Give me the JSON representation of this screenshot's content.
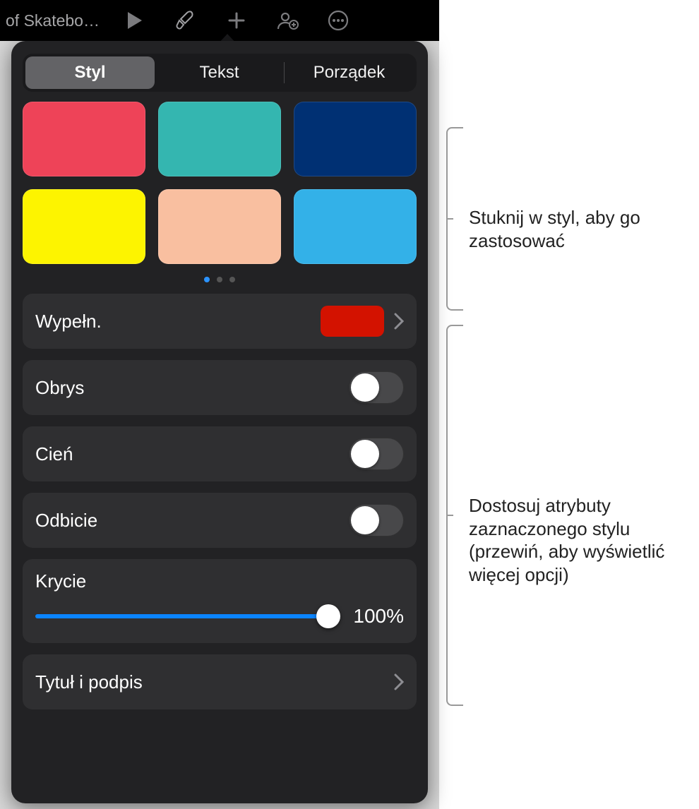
{
  "toolbar": {
    "title": "of Skatebo…"
  },
  "tabs": {
    "style": "Styl",
    "text": "Tekst",
    "arrange": "Porządek"
  },
  "swatches": [
    "#ee4358",
    "#34b6b0",
    "#003073",
    "#fdf400",
    "#f9bfa0",
    "#33b1e8"
  ],
  "active_dot": 0,
  "rows": {
    "fill_label": "Wypełn.",
    "fill_color": "#d31200",
    "stroke_label": "Obrys",
    "shadow_label": "Cień",
    "reflection_label": "Odbicie",
    "opacity_label": "Krycie",
    "opacity_value": "100%",
    "title_caption_label": "Tytuł i podpis"
  },
  "callouts": {
    "top": "Stuknij w styl, aby go zastosować",
    "bottom": "Dostosuj atrybuty zaznaczonego stylu (przewiń, aby wyświetlić więcej opcji)"
  }
}
